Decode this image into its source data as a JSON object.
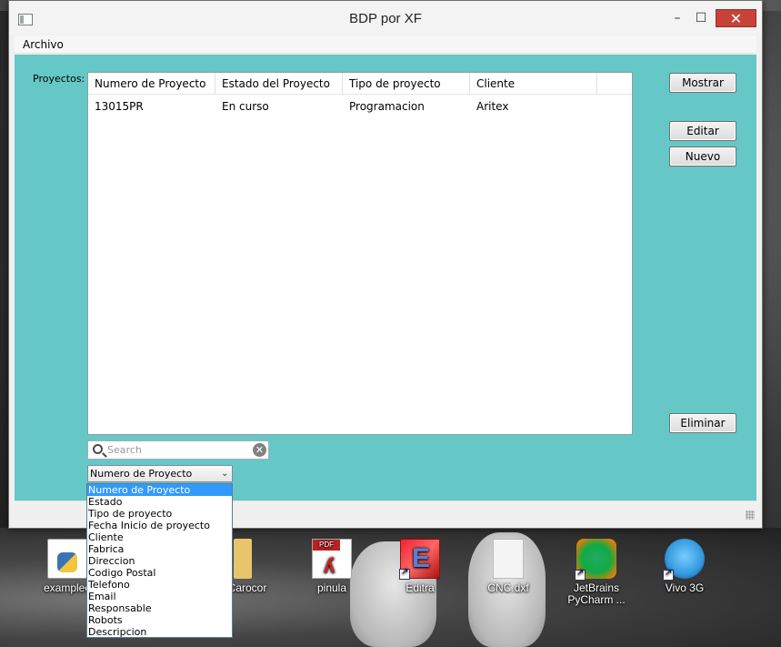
{
  "window": {
    "title": "BDP por XF",
    "controls": {
      "minimize": "–",
      "maximize": "☐",
      "close": "✕"
    }
  },
  "menu": {
    "items": [
      "Archivo"
    ]
  },
  "projects": {
    "label": "Proyectos:",
    "columns": [
      "Numero de Proyecto",
      "Estado del Proyecto",
      "Tipo de proyecto",
      "Cliente"
    ],
    "rows": [
      [
        "13015PR",
        "En curso",
        "Programacion",
        "Aritex"
      ]
    ]
  },
  "buttons": {
    "show": "Mostrar",
    "edit": "Editar",
    "new": "Nuevo",
    "delete": "Eliminar"
  },
  "search": {
    "placeholder": "Search",
    "value": ""
  },
  "filter_combo": {
    "selected": "Numero de Proyecto",
    "options": [
      "Numero de Proyecto",
      "Estado",
      "Tipo de proyecto",
      "Fecha Inicio de proyecto",
      "Cliente",
      "Fabrica",
      "Direccion",
      "Codigo Postal",
      "Telefono",
      "Email",
      "Responsable",
      "Robots",
      "Descripcion"
    ]
  },
  "desktop_icons": [
    {
      "label": "exampleo",
      "icon": "python-file-icon"
    },
    {
      "label": "Carocor",
      "icon": "folder-icon"
    },
    {
      "label": "pinula",
      "icon": "pdf-file-icon"
    },
    {
      "label": "Editra",
      "icon": "editra-app-icon"
    },
    {
      "label": "CNC.dxf",
      "icon": "generic-file-icon"
    },
    {
      "label": "JetBrains PyCharm ...",
      "icon": "pycharm-app-icon"
    },
    {
      "label": "Vivo 3G",
      "icon": "vivo-3g-app-icon"
    }
  ],
  "colors": {
    "client_background": "#65c8c7",
    "close_button": "#c7433a",
    "selection": "#3399ff"
  }
}
